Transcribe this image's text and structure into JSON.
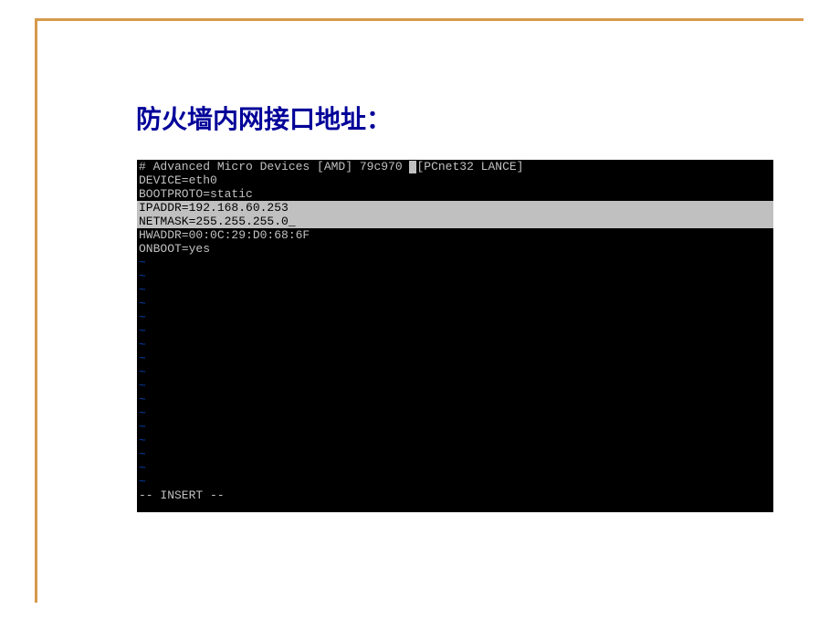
{
  "title": "防火墙内网接口地址：",
  "terminal": {
    "line1_part1": "# Advanced Micro Devices [AMD] 79c970",
    "line1_part2": "[PCnet32 LANCE]",
    "line2": "DEVICE=eth0",
    "line3": "BOOTPROTO=static",
    "hl_line1": "IPADDR=192.168.60.253",
    "hl_line2": "NETMASK=255.255.255.0_",
    "line6": "HWADDR=00:0C:29:D0:68:6F",
    "line7": "ONBOOT=yes",
    "tilde": "~",
    "mode": "-- INSERT --"
  }
}
